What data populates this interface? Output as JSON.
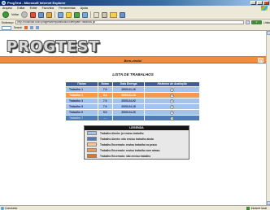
{
  "window": {
    "title": "ProgTest - Microsoft Internet Explorer"
  },
  "menu": [
    "Arquivo",
    "Editar",
    "Exibir",
    "Favoritos",
    "Ferramentas",
    "Ajuda"
  ],
  "toolbar": {
    "back_label": "Voltar",
    "search_label": "Pesquisar",
    "favorites_label": "Favoritos"
  },
  "address": {
    "label": "Endereço",
    "url": "http://localhost:8080/progtest/templates/aluno/templateTrabalhos.jsf",
    "go_label": "Ir",
    "links_label": "Links"
  },
  "links": {
    "search_label": "Search"
  },
  "page": {
    "logo": "PROGTEST",
    "welcome": "Bem-vindo!",
    "heading": "LISTA DE TRABALHOS",
    "columns": [
      "Títulos",
      "Notas",
      "Data Entrega",
      "Histórico de Avaliação"
    ],
    "rows": [
      {
        "title": "Trabalho 1",
        "grade": "7.0",
        "date": "2005-01-16",
        "status": "light-blue"
      },
      {
        "title": "Trabalho 2",
        "grade": "8.0",
        "date": "2005-01-16",
        "status": "orange"
      },
      {
        "title": "Trabalho 3",
        "grade": "7.0",
        "date": "2005-04-02",
        "status": "light-blue"
      },
      {
        "title": "Trabalho 5",
        "grade": "7.0",
        "date": "2005-04-18",
        "status": "light-blue"
      },
      {
        "title": "Trabalho 6",
        "grade": "9.0",
        "date": "2005-04-20",
        "status": "light-blue"
      },
      {
        "title": "Trabalho 7",
        "grade": "---",
        "date": "",
        "status": "dark-blue"
      }
    ]
  },
  "legend": {
    "title": "LEGENDA",
    "items": [
      {
        "text": "Trabalho Aberto: já enviou trabalho",
        "color": "#a4c2ea"
      },
      {
        "text": "Trabalho Aberto: não enviou trabalho ainda",
        "color": "#5279b8"
      },
      {
        "text": "Trabalho Encerrado: enviou trabalho no prazo",
        "color": "#f5c79a"
      },
      {
        "text": "Trabalho Encerrado: enviou trabalho com atraso",
        "color": "#f39a4d"
      },
      {
        "text": "Trabalho Encerrado: não enviou trabalho",
        "color": "#d9762e"
      }
    ]
  },
  "status": {
    "left": "Concluído",
    "right": "Intranet local"
  }
}
